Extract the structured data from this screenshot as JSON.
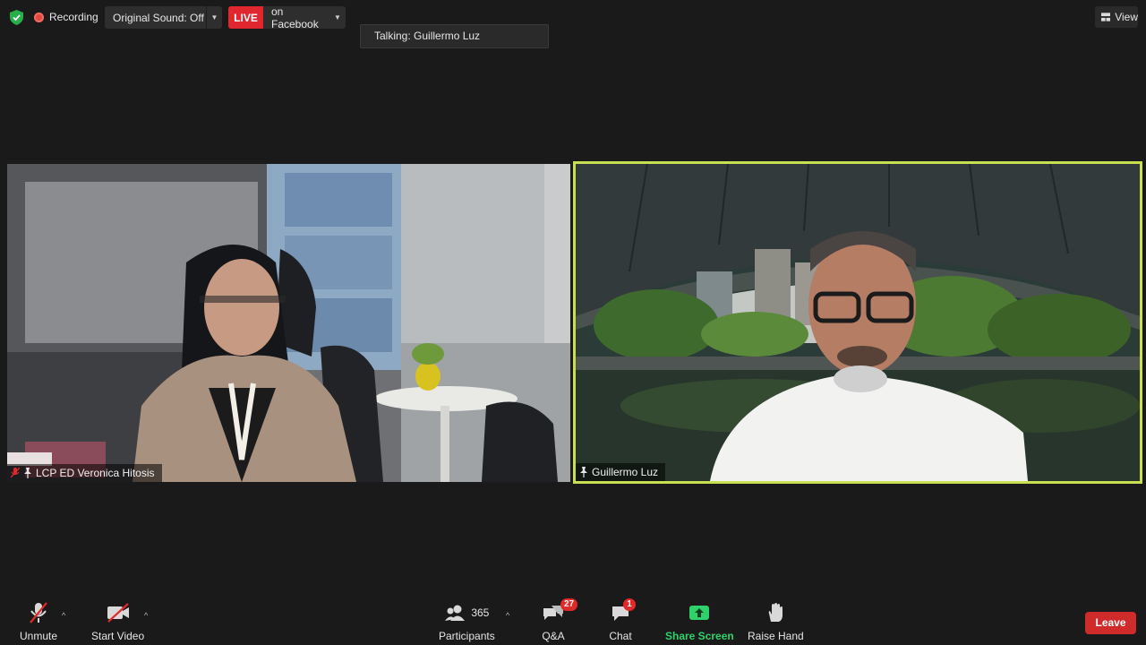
{
  "topbar": {
    "recording_label": "Recording",
    "original_sound_label": "Original Sound: Off",
    "live_badge": "LIVE",
    "live_target": "on Facebook",
    "talking_label": "Talking: Guillermo Luz",
    "view_label": "View"
  },
  "participants": [
    {
      "name": "LCP ED Veronica Hitosis",
      "muted": true,
      "pinned": true
    },
    {
      "name": "Guillermo Luz",
      "muted": false,
      "pinned": true,
      "active_speaker": true
    }
  ],
  "toolbar": {
    "unmute_label": "Unmute",
    "start_video_label": "Start Video",
    "participants_label": "Participants",
    "participants_count": "365",
    "qa_label": "Q&A",
    "qa_badge": "27",
    "chat_label": "Chat",
    "chat_badge": "1",
    "share_screen_label": "Share Screen",
    "raise_hand_label": "Raise Hand",
    "leave_label": "Leave"
  },
  "colors": {
    "background": "#1a1a1a",
    "active_speaker_border": "#c8df53",
    "live_red": "#e0262f",
    "share_green": "#2fd16b",
    "leave_red": "#cf2b2b"
  },
  "icons": [
    "shield-icon",
    "record-dot-icon",
    "chevron-down-icon",
    "view-grid-icon",
    "microphone-muted-icon",
    "pin-icon",
    "video-off-icon",
    "participants-icon",
    "qa-icon",
    "chat-icon",
    "share-screen-icon",
    "raise-hand-icon"
  ]
}
